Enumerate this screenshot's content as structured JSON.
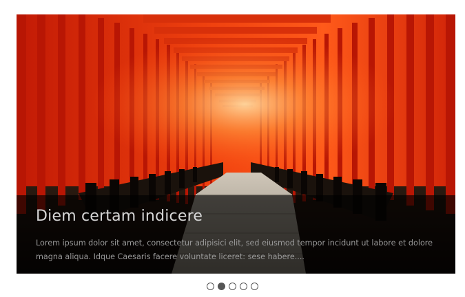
{
  "slider": {
    "image_name": "torii-gates-path-photo",
    "caption": {
      "title": "Diem certam indicere",
      "text": "Lorem ipsum dolor sit amet, consectetur adipisici elit, sed eiusmod tempor incidunt ut labore et dolore magna aliqua. Idque Caesaris facere voluntate liceret: sese habere...."
    },
    "pager": {
      "count": 5,
      "active_index": 2
    }
  },
  "colors": {
    "gate_red": "#e8320c",
    "caption_bg": "#000000",
    "dot": "#555555"
  }
}
